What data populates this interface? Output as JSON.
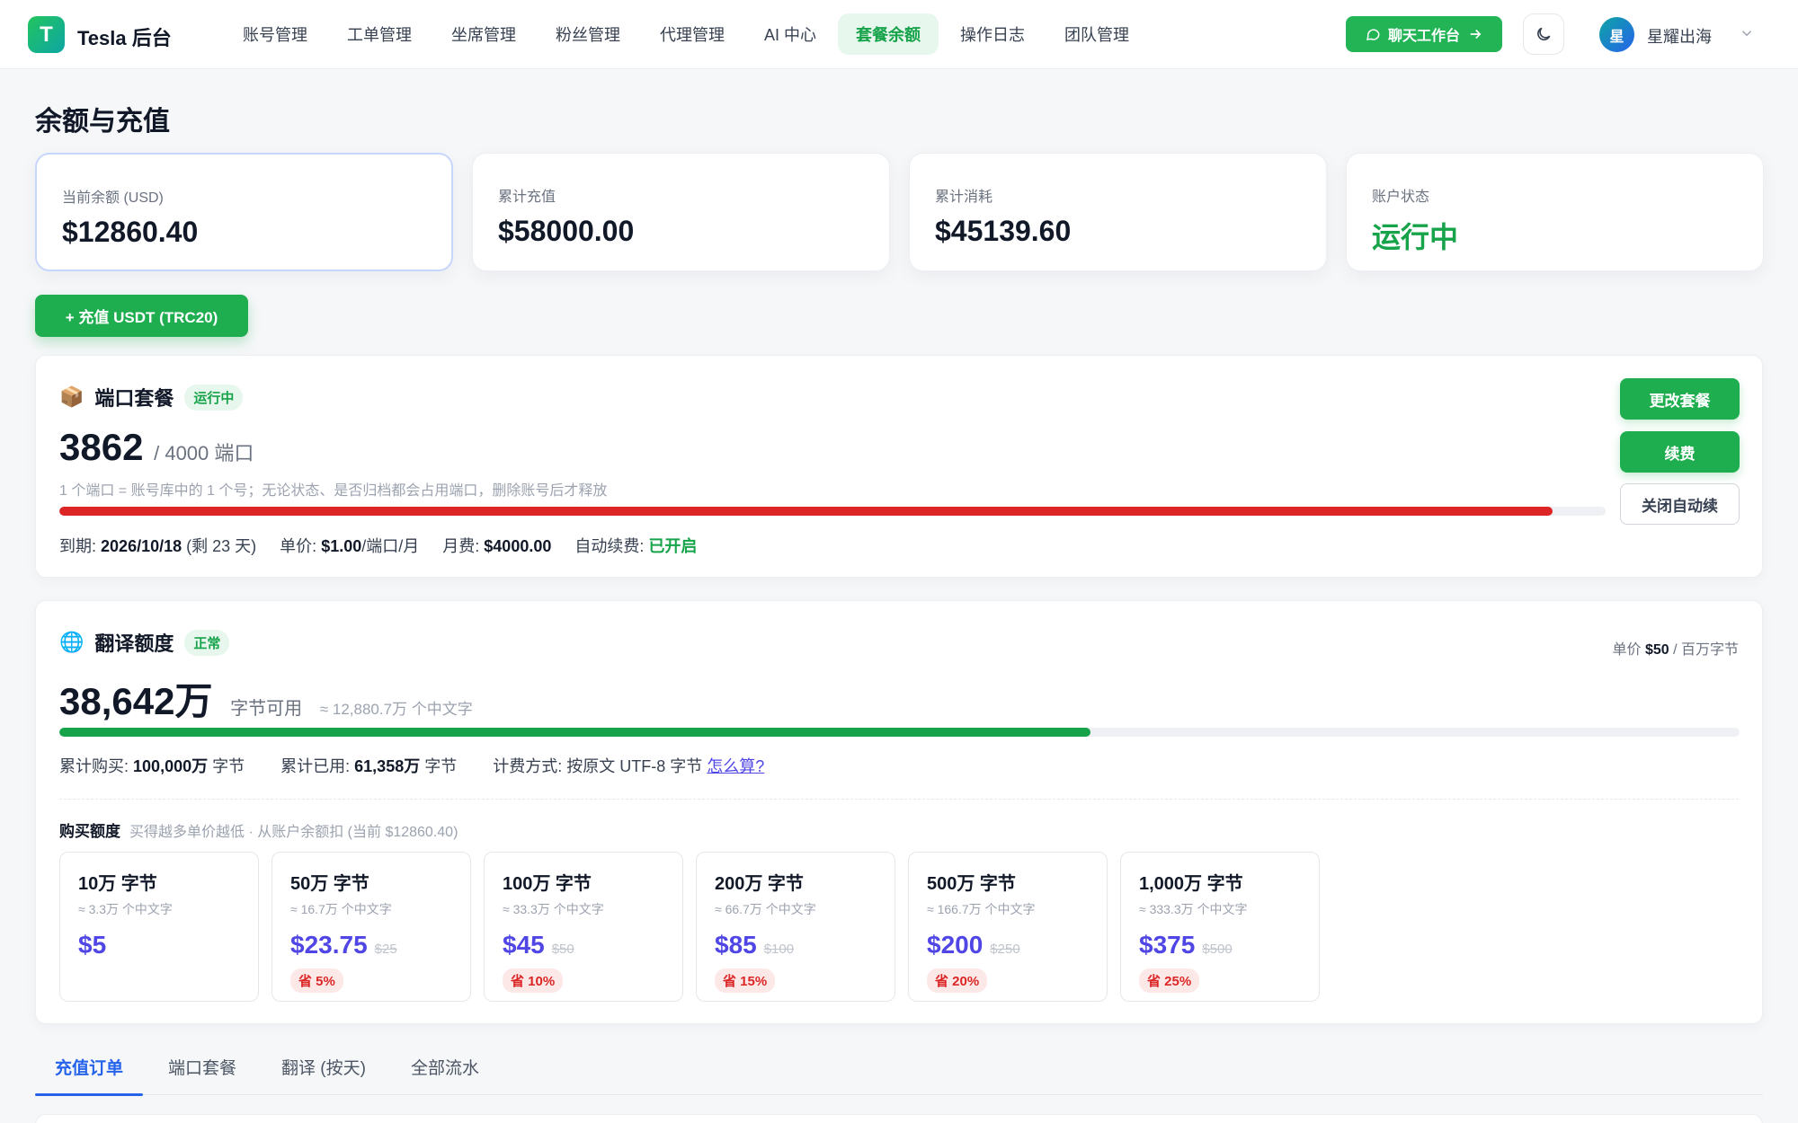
{
  "app": {
    "logo_letter": "T",
    "brand": "Tesla 后台"
  },
  "nav": {
    "items": [
      {
        "label": "账号管理",
        "active": false
      },
      {
        "label": "工单管理",
        "active": false
      },
      {
        "label": "坐席管理",
        "active": false
      },
      {
        "label": "粉丝管理",
        "active": false
      },
      {
        "label": "代理管理",
        "active": false
      },
      {
        "label": "AI 中心",
        "active": false
      },
      {
        "label": "套餐余额",
        "active": true
      },
      {
        "label": "操作日志",
        "active": false
      },
      {
        "label": "团队管理",
        "active": false
      }
    ],
    "chat_button": "聊天工作台",
    "user_avatar": "星",
    "user_name": "星耀出海"
  },
  "page": {
    "title": "余额与充值",
    "recharge_button": "+ 充值 USDT (TRC20)"
  },
  "stats": [
    {
      "label": "当前余额 (USD)",
      "value": "$12860.40"
    },
    {
      "label": "累计充值",
      "value": "$58000.00"
    },
    {
      "label": "累计消耗",
      "value": "$45139.60"
    },
    {
      "label": "账户状态",
      "value": "运行中"
    }
  ],
  "port_plan": {
    "icon": "📦",
    "title": "端口套餐",
    "badge": "运行中",
    "used": "3862",
    "total_text": "/ 4000 端口",
    "usage_fraction": 0.9655,
    "bar_color": "#dc2626",
    "note": "1 个端口 = 账号库中的 1 个号；无论状态、是否归档都会占用端口，删除账号后才释放",
    "expire_label": "到期:",
    "expire_value": "2026/10/18",
    "expire_remaining": "(剩 23 天)",
    "unit_price_label": "单价:",
    "unit_price_value": "$1.00",
    "unit_price_unit": "/端口/月",
    "monthly_label": "月费:",
    "monthly_value": "$4000.00",
    "auto_renew_label": "自动续费:",
    "auto_renew_value": "已开启",
    "btn_change": "更改套餐",
    "btn_renew": "续费",
    "btn_close_auto": "关闭自动续"
  },
  "translation": {
    "icon": "🌐",
    "title": "翻译额度",
    "badge": "正常",
    "unit_price_prefix": "单价",
    "unit_price_value": "$50",
    "unit_price_suffix": "/ 百万字节",
    "available": "38,642万",
    "available_label": "字节可用",
    "available_approx": "≈ 12,880.7万 个中文字",
    "usage_fraction": 0.6136,
    "bar_color": "#16a34a",
    "purchased_label": "累计购买:",
    "purchased_value": "100,000万",
    "purchased_unit": "字节",
    "used_label": "累计已用:",
    "used_value": "61,358万",
    "used_unit": "字节",
    "billing_text": "计费方式: 按原文 UTF-8 字节",
    "billing_link": "怎么算?",
    "buy_title": "购买额度",
    "buy_subtitle": "买得越多单价越低 · 从账户余额扣 (当前 $12860.40)",
    "packages": [
      {
        "name": "10万 字节",
        "approx": "≈ 3.3万 个中文字",
        "price": "$5",
        "orig": "",
        "save": ""
      },
      {
        "name": "50万 字节",
        "approx": "≈ 16.7万 个中文字",
        "price": "$23.75",
        "orig": "$25",
        "save": "省 5%"
      },
      {
        "name": "100万 字节",
        "approx": "≈ 33.3万 个中文字",
        "price": "$45",
        "orig": "$50",
        "save": "省 10%"
      },
      {
        "name": "200万 字节",
        "approx": "≈ 66.7万 个中文字",
        "price": "$85",
        "orig": "$100",
        "save": "省 15%"
      },
      {
        "name": "500万 字节",
        "approx": "≈ 166.7万 个中文字",
        "price": "$200",
        "orig": "$250",
        "save": "省 20%"
      },
      {
        "name": "1,000万 字节",
        "approx": "≈ 333.3万 个中文字",
        "price": "$375",
        "orig": "$500",
        "save": "省 25%"
      }
    ]
  },
  "tabs": [
    {
      "label": "充值订单",
      "active": true
    },
    {
      "label": "端口套餐",
      "active": false
    },
    {
      "label": "翻译 (按天)",
      "active": false
    },
    {
      "label": "全部流水",
      "active": false
    }
  ]
}
